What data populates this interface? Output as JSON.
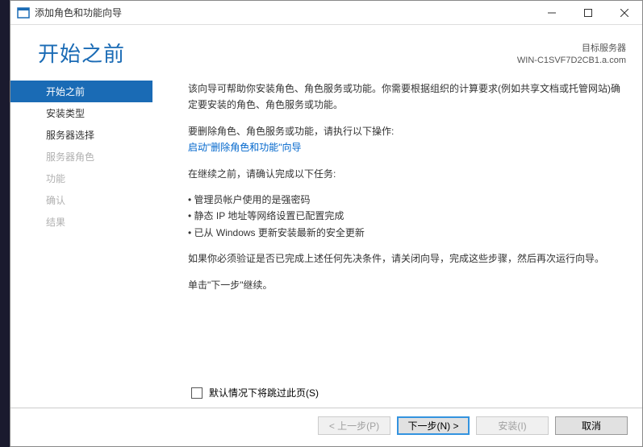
{
  "titlebar": {
    "title": "添加角色和功能向导"
  },
  "header": {
    "page_title": "开始之前",
    "dest_label": "目标服务器",
    "dest_value": "WIN-C1SVF7D2CB1.a.com"
  },
  "sidebar": {
    "items": [
      {
        "label": "开始之前",
        "state": "active"
      },
      {
        "label": "安装类型",
        "state": "enabled"
      },
      {
        "label": "服务器选择",
        "state": "enabled"
      },
      {
        "label": "服务器角色",
        "state": "disabled"
      },
      {
        "label": "功能",
        "state": "disabled"
      },
      {
        "label": "确认",
        "state": "disabled"
      },
      {
        "label": "结果",
        "state": "disabled"
      }
    ]
  },
  "content": {
    "intro": "该向导可帮助你安装角色、角色服务或功能。你需要根据组织的计算要求(例如共享文档或托管网站)确定要安装的角色、角色服务或功能。",
    "remove_label": "要删除角色、角色服务或功能，请执行以下操作:",
    "remove_link": "启动\"删除角色和功能\"向导",
    "before_continue": "在继续之前，请确认完成以下任务:",
    "tasks": [
      "管理员帐户使用的是强密码",
      "静态 IP 地址等网络设置已配置完成",
      "已从 Windows 更新安装最新的安全更新"
    ],
    "verify_note": "如果你必须验证是否已完成上述任何先决条件，请关闭向导，完成这些步骤，然后再次运行向导。",
    "continue_note": "单击\"下一步\"继续。"
  },
  "footer": {
    "skip_label": "默认情况下将跳过此页(S)"
  },
  "buttons": {
    "prev": "< 上一步(P)",
    "next": "下一步(N) >",
    "install": "安装(I)",
    "cancel": "取消"
  }
}
